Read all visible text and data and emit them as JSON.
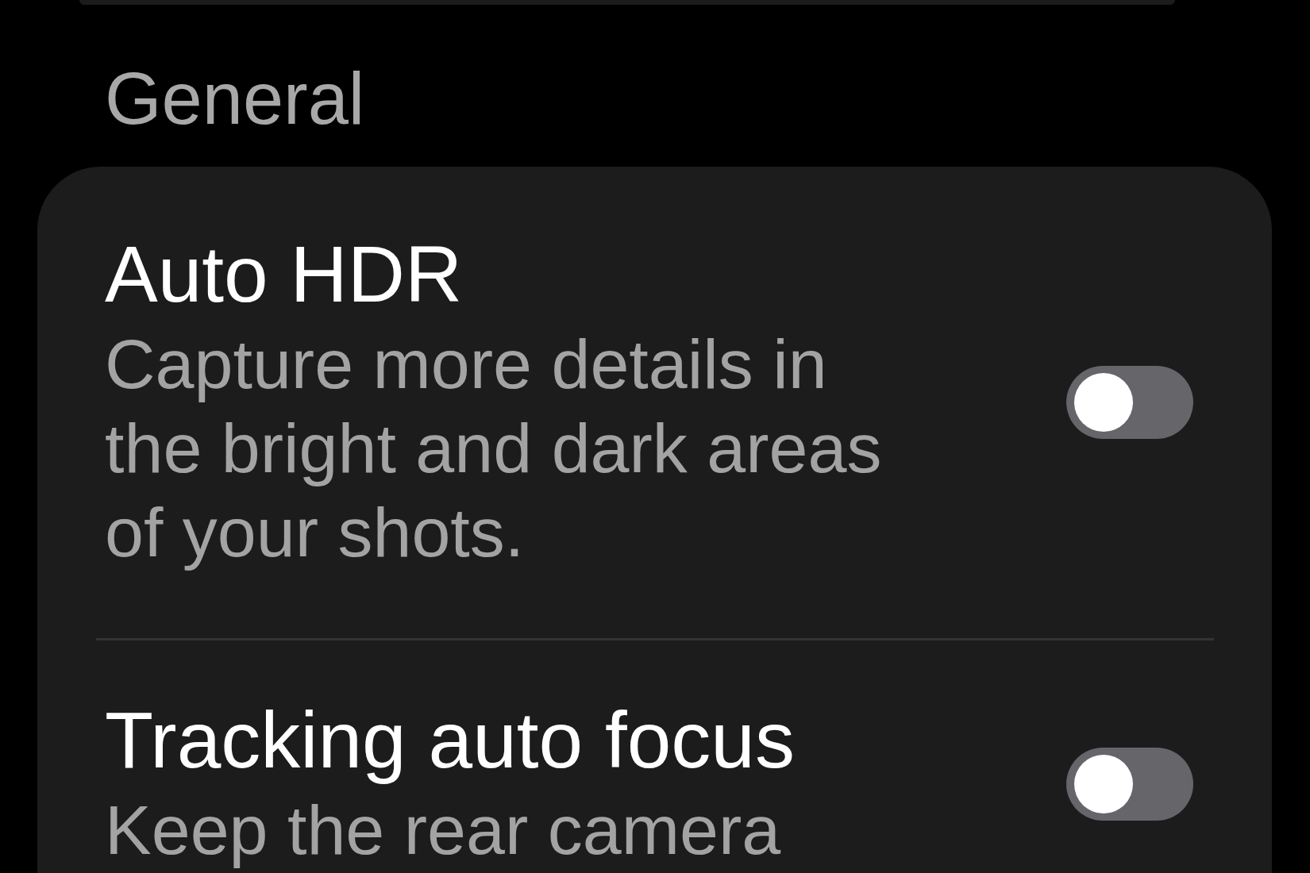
{
  "section": {
    "title": "General"
  },
  "settings": [
    {
      "title": "Auto HDR",
      "description": "Capture more details in the bright and dark areas of your shots.",
      "on": false
    },
    {
      "title": "Tracking auto focus",
      "description": "Keep the rear camera",
      "on": false
    }
  ]
}
